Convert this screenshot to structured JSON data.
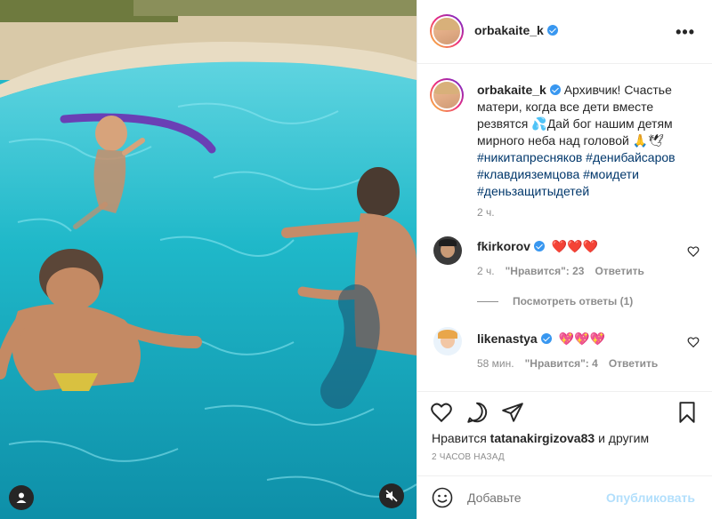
{
  "post": {
    "username": "orbakaite_k",
    "more_icon": "•••",
    "caption_text": "Архивчик! Счастье матери, когда все дети вместе резвятся 💦Дай бог нашим детям мирного неба над головой 🙏🕊",
    "hashtags": "#никитапресняков #денибайсаров #клавдияземцова #моидети #деньзащитыдетей",
    "time": "2 ч."
  },
  "comments": [
    {
      "username": "fkirkorov",
      "text": "❤️❤️❤️",
      "time": "2 ч.",
      "likes": "\"Нравится\": 23",
      "reply": "Ответить"
    },
    {
      "username": "likenastya",
      "text": "💖💖💖",
      "time": "58 мин.",
      "likes": "\"Нравится\": 4",
      "reply": "Ответить"
    }
  ],
  "view_replies": "Посмотреть ответы (1)",
  "likes": {
    "prefix": "Нравится",
    "user": "tatanakirgizova83",
    "suffix": "и другим"
  },
  "date": "2 ЧАСОВ НАЗАД",
  "add_comment": {
    "placeholder": "Добавьте",
    "publish": "Опубликовать"
  },
  "colors": {
    "link": "#00376b",
    "muted": "#8e8e8e",
    "verified": "#3897f0",
    "heart": "#ed4956",
    "publish_disabled": "#b2dffc",
    "pool": "#20b7c8"
  },
  "icons": [
    "user-icon",
    "mute-icon",
    "heart-icon",
    "comment-icon",
    "share-icon",
    "bookmark-icon",
    "emoji-icon",
    "more-icon",
    "verified-icon"
  ]
}
